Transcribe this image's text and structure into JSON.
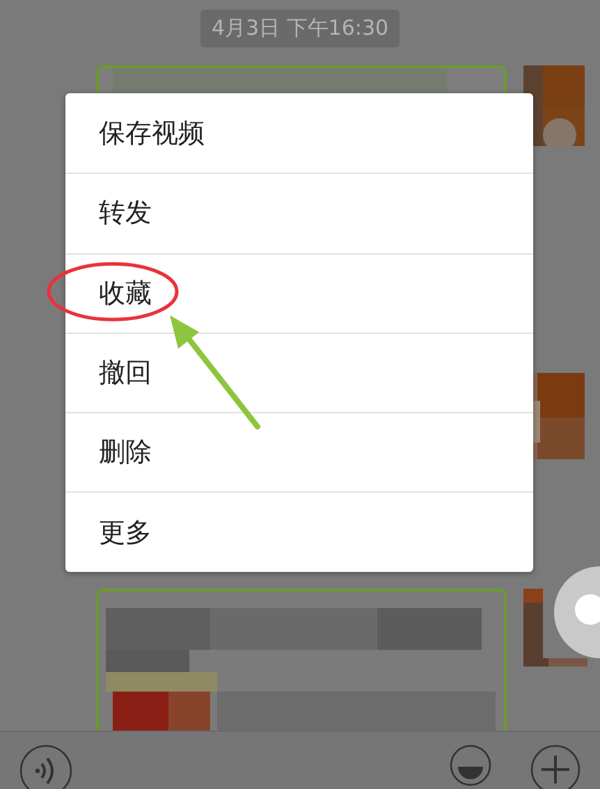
{
  "timestamp": "4月3日 下午16:30",
  "menu": {
    "items": [
      {
        "label": "保存视频",
        "circled": false
      },
      {
        "label": "转发",
        "circled": false
      },
      {
        "label": "收藏",
        "circled": true
      },
      {
        "label": "撤回",
        "circled": false
      },
      {
        "label": "删除",
        "circled": false
      },
      {
        "label": "更多",
        "circled": false
      }
    ]
  }
}
